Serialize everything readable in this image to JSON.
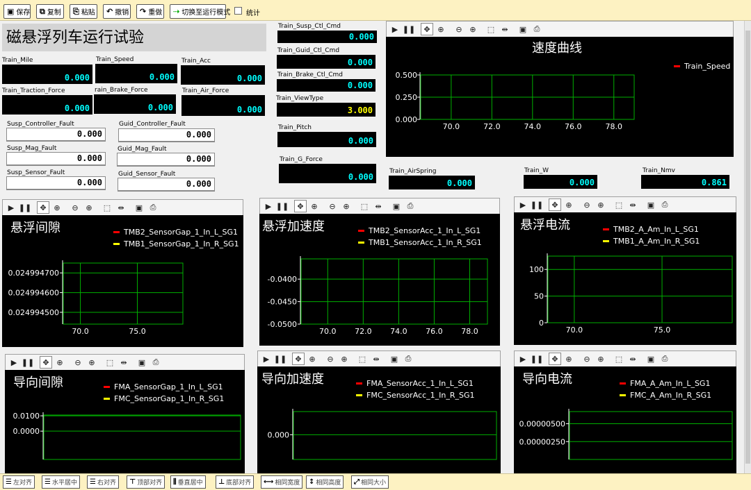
{
  "toolbar": [
    {
      "label": "保存",
      "icon": "save-icon",
      "glyph": "▣"
    },
    {
      "label": "复制",
      "icon": "copy-icon",
      "glyph": "⧉"
    },
    {
      "label": "粘贴",
      "icon": "paste-icon",
      "glyph": "⎘"
    },
    {
      "label": "撤销",
      "icon": "undo-icon",
      "glyph": "↶"
    },
    {
      "label": "重做",
      "icon": "redo-icon",
      "glyph": "↷"
    },
    {
      "label": "切换至运行模式",
      "icon": "run-mode-icon",
      "glyph": "⇢"
    }
  ],
  "stats_label": "统计",
  "page_title": "磁悬浮列车运行试验",
  "fields": {
    "train_mile": {
      "label": "Train_Mile",
      "value": "0.000"
    },
    "train_speed": {
      "label": "Train_Speed",
      "value": "0.000"
    },
    "train_acc": {
      "label": "Train_Acc",
      "value": "0.000"
    },
    "train_traction_force": {
      "label": "Train_Traction_Force",
      "value": "0.000"
    },
    "train_brake_force": {
      "label": "rain_Brake_Force",
      "value": "0.000"
    },
    "train_air_force": {
      "label": "Train_Air_Force",
      "value": "0.000"
    },
    "susp_controller_fault": {
      "label": "Susp_Controller_Fault",
      "value": "0.000"
    },
    "guid_controller_fault": {
      "label": "Guid_Controller_Fault",
      "value": "0.000"
    },
    "susp_mag_fault": {
      "label": "Susp_Mag_Fault",
      "value": "0.000"
    },
    "guid_mag_fault": {
      "label": "Guid_Mag_Fault",
      "value": "0.000"
    },
    "susp_sensor_fault": {
      "label": "Susp_Sensor_Fault",
      "value": "0.000"
    },
    "guid_sensor_fault": {
      "label": "Guid_Sensor_Fault",
      "value": "0.000"
    },
    "train_susp_ctl_cmd": {
      "label": "Train_Susp_Ctl_Cmd",
      "value": "0.000"
    },
    "train_guid_ctl_cmd": {
      "label": "Train_Guid_Ctl_Cmd",
      "value": "0.000"
    },
    "train_brake_ctl_cmd": {
      "label": "Train_Brake_Ctl_Cmd",
      "value": "0.000"
    },
    "train_viewtype": {
      "label": "Train_ViewType",
      "value": "3.000"
    },
    "train_pitch": {
      "label": "Train_Pitch",
      "value": "0.000"
    },
    "train_g_force": {
      "label": "Train_G_Force",
      "value": "0.000"
    },
    "train_airspring": {
      "label": "Train_AirSpring",
      "value": "0.000"
    },
    "train_w": {
      "label": "Train_W",
      "value": "0.000"
    },
    "train_nmv": {
      "label": "Train_Nmv",
      "value": "0.861"
    }
  },
  "chart_toolbar_icons": [
    "play-icon",
    "pause-icon",
    "pan-icon",
    "zoom-area-icon",
    "zoom-out-icon",
    "zoom-in-icon",
    "select-box-icon",
    "fit-icon",
    "save-icon",
    "print-icon"
  ],
  "chart_data": [
    {
      "type": "line",
      "title": "速度曲线",
      "series": [
        {
          "name": "Train_Speed",
          "color": "#ff0000",
          "x": [],
          "y": []
        }
      ],
      "xticks": [
        "70.0",
        "72.0",
        "74.0",
        "76.0",
        "78.0"
      ],
      "yticks": [
        "0.000",
        "0.250",
        "0.500"
      ],
      "xlim": [
        68.5,
        79.0
      ],
      "ylim": [
        0,
        0.5
      ],
      "grid": true,
      "legend": "right"
    },
    {
      "type": "line",
      "title": "悬浮间隙",
      "series": [
        {
          "name": "TMB2_SensorGap_1_In_L_SG1",
          "color": "#ff0000",
          "x": [],
          "y": []
        },
        {
          "name": "TMB1_SensorGap_1_In_R_SG1",
          "color": "#ffff00",
          "x": [],
          "y": []
        }
      ],
      "xticks": [
        "70.0",
        "75.0"
      ],
      "yticks": [
        "0.024994500",
        "0.024994600",
        "0.024994700"
      ],
      "xlim": [
        68.5,
        79.0
      ],
      "ylim": [
        0.02499444,
        0.02499475
      ],
      "grid": true,
      "legend": "top"
    },
    {
      "type": "line",
      "title": "悬浮加速度",
      "series": [
        {
          "name": "TMB2_SensorAcc_1_In_L_SG1",
          "color": "#ff0000",
          "x": [],
          "y": []
        },
        {
          "name": "TMB1_SensorAcc_1_In_R_SG1",
          "color": "#ffff00",
          "x": [],
          "y": []
        }
      ],
      "xticks": [
        "70.0",
        "72.0",
        "74.0",
        "76.0",
        "78.0"
      ],
      "yticks": [
        "-0.0500",
        "-0.0450",
        "-0.0400"
      ],
      "xlim": [
        68.5,
        79.0
      ],
      "ylim": [
        -0.05,
        -0.0355
      ],
      "grid": true,
      "legend": "top"
    },
    {
      "type": "line",
      "title": "悬浮电流",
      "series": [
        {
          "name": "TMB2_A_Am_In_L_SG1",
          "color": "#ff0000",
          "x": [],
          "y": []
        },
        {
          "name": "TMB1_A_Am_In_R_SG1",
          "color": "#ffff00",
          "x": [],
          "y": []
        }
      ],
      "xticks": [
        "70.0",
        "75.0"
      ],
      "yticks": [
        "0",
        "50",
        "100"
      ],
      "xlim": [
        68.5,
        79.0
      ],
      "ylim": [
        0,
        125
      ],
      "grid": true,
      "legend": "top"
    },
    {
      "type": "line",
      "title": "导向间隙",
      "series": [
        {
          "name": "FMA_SensorGap_1_In_L_SG1",
          "color": "#ff0000",
          "x": [],
          "y": []
        },
        {
          "name": "FMC_SensorGap_1_In_R_SG1",
          "color": "#ffff00",
          "x": [],
          "y": []
        }
      ],
      "xticks": [],
      "yticks": [
        "0.0000",
        "0.0100"
      ],
      "xlim": [
        68.5,
        79.0
      ],
      "ylim": [
        -0.0185,
        0.0105
      ],
      "grid": true,
      "legend": "top"
    },
    {
      "type": "line",
      "title": "导向加速度",
      "series": [
        {
          "name": "FMA_SensorAcc_1_In_L_SG1",
          "color": "#ff0000",
          "x": [],
          "y": []
        },
        {
          "name": "FMC_SensorAcc_1_In_R_SG1",
          "color": "#ffff00",
          "x": [],
          "y": []
        }
      ],
      "xticks": [],
      "yticks": [
        "0.000"
      ],
      "xlim": [
        68.5,
        79.0
      ],
      "ylim": [
        -0.0016,
        0.0015
      ],
      "grid": true,
      "legend": "top"
    },
    {
      "type": "line",
      "title": "导向电流",
      "series": [
        {
          "name": "FMA_A_Am_In_L_SG1",
          "color": "#ff0000",
          "x": [],
          "y": []
        },
        {
          "name": "FMC_A_Am_In_R_SG1",
          "color": "#ffff00",
          "x": [],
          "y": []
        }
      ],
      "xticks": [],
      "yticks": [
        "0.00000250",
        "0.00000500"
      ],
      "xlim": [
        68.5,
        79.0
      ],
      "ylim": [
        0,
        6.7e-06
      ],
      "grid": true,
      "legend": "top"
    }
  ],
  "bottom_toolbar": [
    {
      "label": "左对齐",
      "icon": "align-left-icon",
      "glyph": "☰"
    },
    {
      "label": "水平居中",
      "icon": "align-hcenter-icon",
      "glyph": "☰"
    },
    {
      "label": "右对齐",
      "icon": "align-right-icon",
      "glyph": "☰"
    },
    {
      "label": "顶部对齐",
      "icon": "align-top-icon",
      "glyph": "⊤"
    },
    {
      "label": "垂直居中",
      "icon": "align-vcenter-icon",
      "glyph": "⫼"
    },
    {
      "label": "底部对齐",
      "icon": "align-bottom-icon",
      "glyph": "⊥"
    },
    {
      "label": "相同宽度",
      "icon": "same-width-icon",
      "glyph": "⟷"
    },
    {
      "label": "相同高度",
      "icon": "same-height-icon",
      "glyph": "↕"
    },
    {
      "label": "相同大小",
      "icon": "same-size-icon",
      "glyph": "⤢"
    }
  ]
}
